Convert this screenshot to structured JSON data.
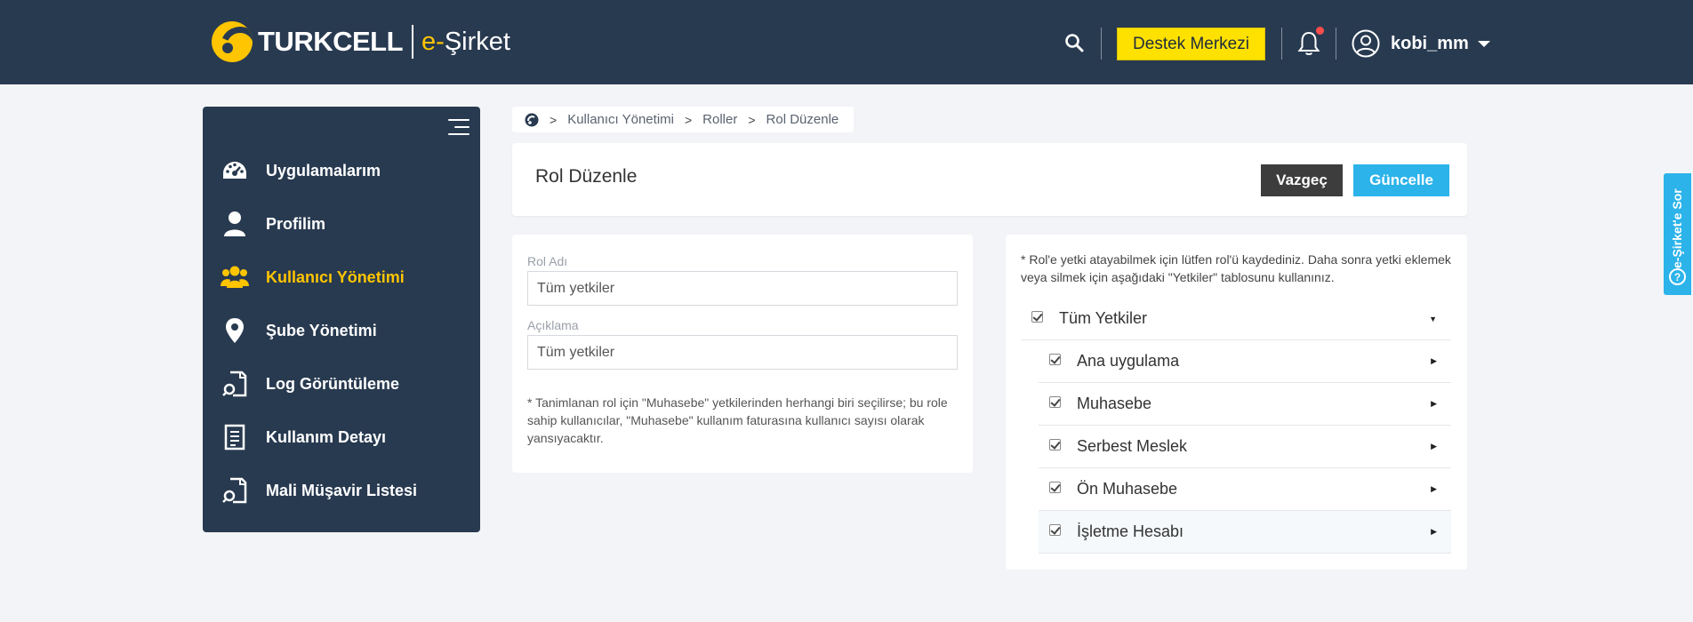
{
  "header": {
    "brand": "TURKCELL",
    "product_prefix": "e-",
    "product_name": "Şirket",
    "support_label": "Destek Merkezi",
    "username": "kobi_mm",
    "accent": "#ffc500"
  },
  "sidebar": {
    "items": [
      {
        "label": "Uygulamalarım",
        "icon": "dashboard-icon",
        "active": false
      },
      {
        "label": "Profilim",
        "icon": "user-icon",
        "active": false
      },
      {
        "label": "Kullanıcı Yönetimi",
        "icon": "users-icon",
        "active": true
      },
      {
        "label": "Şube Yönetimi",
        "icon": "location-pin-icon",
        "active": false
      },
      {
        "label": "Log Görüntüleme",
        "icon": "document-search-icon",
        "active": false
      },
      {
        "label": "Kullanım Detayı",
        "icon": "document-list-icon",
        "active": false
      },
      {
        "label": "Mali Müşavir Listesi",
        "icon": "document-search-icon",
        "active": false
      }
    ]
  },
  "breadcrumb": {
    "home_icon": "turkcell-logo-icon",
    "items": [
      "Kullanıcı Yönetimi",
      "Roller",
      "Rol Düzenle"
    ]
  },
  "page": {
    "title": "Rol Düzenle",
    "cancel_label": "Vazgeç",
    "update_label": "Güncelle"
  },
  "form": {
    "role_name_label": "Rol Adı",
    "role_name_value": "Tüm yetkiler",
    "description_label": "Açıklama",
    "description_value": "Tüm yetkiler",
    "note": "* Tanimlanan rol için \"Muhasebe\" yetkilerinden herhangi biri seçilirse; bu role sahip kullanıcılar, \"Muhasebe\" kullanım faturasına kullanıcı sayısı olarak yansıyacaktır."
  },
  "permissions": {
    "note": "* Rol'e yetki atayabilmek için lütfen rol'ü kaydediniz. Daha sonra yetki eklemek veya silmek için aşağıdaki \"Yetkiler\" tablosunu kullanınız.",
    "root": {
      "label": "Tüm Yetkiler",
      "checked": true
    },
    "children": [
      {
        "label": "Ana uygulama",
        "checked": true
      },
      {
        "label": "Muhasebe",
        "checked": true
      },
      {
        "label": "Serbest Meslek",
        "checked": true
      },
      {
        "label": "Ön Muhasebe",
        "checked": true
      },
      {
        "label": "İşletme Hesabı",
        "checked": true
      }
    ]
  },
  "side_tab": {
    "label": "e-Şirket'e Sor",
    "icon_char": "?"
  }
}
